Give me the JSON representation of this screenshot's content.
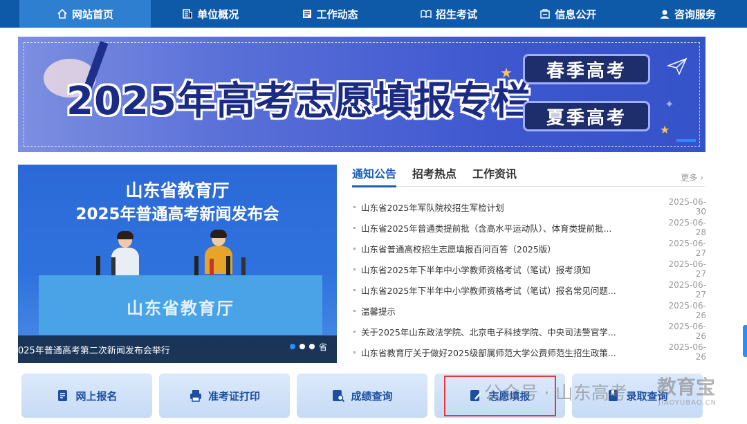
{
  "nav": {
    "items": [
      {
        "label": "网站首页",
        "icon": "home-icon"
      },
      {
        "label": "单位概况",
        "icon": "building-icon"
      },
      {
        "label": "工作动态",
        "icon": "news-icon"
      },
      {
        "label": "招生考试",
        "icon": "book-icon"
      },
      {
        "label": "信息公开",
        "icon": "info-icon"
      },
      {
        "label": "咨询服务",
        "icon": "user-icon"
      }
    ]
  },
  "banner": {
    "title": "2025年高考志愿填报专栏",
    "spring_label": "春季高考",
    "summer_label": "夏季高考"
  },
  "photo": {
    "heading1": "山东省教育厅",
    "heading2": "2025年普通高考新闻发布会",
    "desk_label": "山东省教育厅",
    "caption": "025年普通高考第二次新闻发布会举行",
    "caption_tail": "省"
  },
  "news_tabs": {
    "tabs": [
      "通知公告",
      "招考热点",
      "工作资讯"
    ],
    "more": "更多"
  },
  "news": [
    {
      "title": "山东省2025年军队院校招生军检计划",
      "date": "2025-06-30"
    },
    {
      "title": "山东省2025年普通类提前批（含高水平运动队）、体育类提前批...",
      "date": "2025-06-28"
    },
    {
      "title": "山东省普通高校招生志愿填报百问百答（2025版）",
      "date": "2025-06-27"
    },
    {
      "title": "山东省2025年下半年中小学教师资格考试（笔试）报考须知",
      "date": "2025-06-27"
    },
    {
      "title": "山东省2025年下半年中小学教师资格考试（笔试）报名常见问题...",
      "date": "2025-06-27"
    },
    {
      "title": "温馨提示",
      "date": "2025-06-26"
    },
    {
      "title": "关于2025年山东政法学院、北京电子科技学院、中央司法警官学...",
      "date": "2025-06-26"
    },
    {
      "title": "山东省教育厅关于做好2025级部属师范大学公费师范生招生政策...",
      "date": "2025-06-26"
    }
  ],
  "quick_links": [
    {
      "label": "网上报名",
      "icon": "form-icon"
    },
    {
      "label": "准考证打印",
      "icon": "printer-icon"
    },
    {
      "label": "成绩查询",
      "icon": "search-doc-icon"
    },
    {
      "label": "志愿填报",
      "icon": "edit-doc-icon"
    },
    {
      "label": "录取查询",
      "icon": "bookmark-icon"
    }
  ],
  "watermark": {
    "text1": "公众号 · 山东高考",
    "text2": "教育宝",
    "text3": "JIAOYUBAO.CN"
  }
}
